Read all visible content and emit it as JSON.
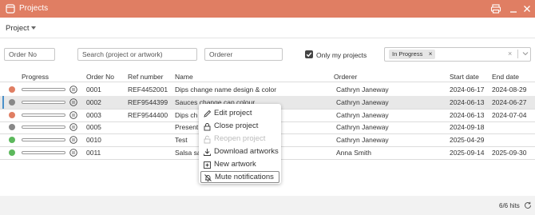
{
  "window": {
    "title": "Projects"
  },
  "menubar": {
    "project_menu": "Project"
  },
  "filters": {
    "order_no_placeholder": "Order No",
    "search_placeholder": "Search (project or artwork)",
    "orderer_placeholder": "Orderer",
    "only_my_projects": {
      "label": "Only my projects",
      "checked": true
    },
    "status_tag": "In Progress",
    "tag_remove": "×",
    "clear_glyph": "×"
  },
  "table": {
    "headers": {
      "progress": "Progress",
      "order_no": "Order No",
      "ref_number": "Ref number",
      "name": "Name",
      "orderer": "Orderer",
      "start_date": "Start date",
      "end_date": "End date"
    },
    "rows": [
      {
        "status_color": "#e07e63",
        "order_no": "0001",
        "ref": "REF4452001",
        "name": "Dips change name design & color",
        "orderer": "Cathryn Janeway",
        "start": "2024-06-17",
        "end": "2024-08-29",
        "selected": false
      },
      {
        "status_color": "#888888",
        "order_no": "0002",
        "ref": "REF9544399",
        "name": "Sauces change cap colour",
        "orderer": "Cathryn Janeway",
        "start": "2024-06-13",
        "end": "2024-06-27",
        "selected": true
      },
      {
        "status_color": "#e07e63",
        "order_no": "0003",
        "ref": "REF9544400",
        "name": "Dips ch",
        "orderer": "Cathryn Janeway",
        "start": "2024-06-13",
        "end": "2024-07-04",
        "selected": false
      },
      {
        "status_color": "#888888",
        "order_no": "0005",
        "ref": "",
        "name": "Present",
        "orderer": "Cathryn Janeway",
        "start": "2024-09-18",
        "end": "",
        "selected": false
      },
      {
        "status_color": "#5cb85c",
        "order_no": "0010",
        "ref": "",
        "name": "Test",
        "orderer": "Cathryn Janeway",
        "start": "2025-04-29",
        "end": "",
        "selected": false
      },
      {
        "status_color": "#5cb85c",
        "order_no": "0011",
        "ref": "",
        "name": "Salsa sa",
        "orderer": "Anna Smith",
        "start": "2025-09-14",
        "end": "2025-09-30",
        "selected": false
      }
    ]
  },
  "context_menu": {
    "items": [
      {
        "label": "Edit project",
        "icon": "pencil-icon",
        "disabled": false
      },
      {
        "label": "Close project",
        "icon": "lock-icon",
        "disabled": false
      },
      {
        "label": "Reopen project",
        "icon": "unlock-icon",
        "disabled": true
      },
      {
        "label": "Download artworks",
        "icon": "download-icon",
        "disabled": false
      },
      {
        "label": "New artwork",
        "icon": "plus-square-icon",
        "disabled": false
      },
      {
        "label": "Mute notifications",
        "icon": "bell-slash-icon",
        "disabled": false
      }
    ]
  },
  "footer": {
    "hits": "6/6 hits"
  },
  "colors": {
    "titlebar": "#e07e63",
    "selection_marker": "#4a90c9"
  }
}
